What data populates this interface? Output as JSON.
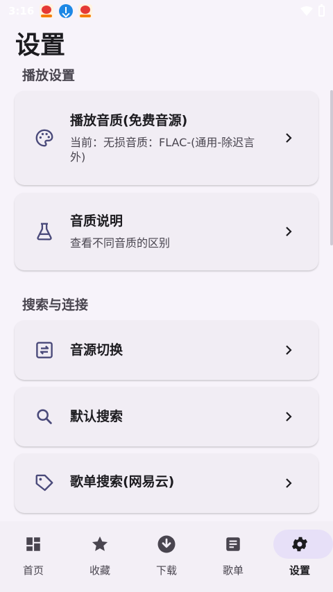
{
  "status_bar": {
    "time": "3:16",
    "notification_icons": [
      "app-notification-icon",
      "download-icon",
      "app-notification-icon"
    ],
    "right_icons": [
      "wifi-icon",
      "battery-icon"
    ]
  },
  "page": {
    "title": "设置"
  },
  "sections": [
    {
      "header": "播放设置",
      "items": [
        {
          "icon": "palette-icon",
          "title": "播放音质(免费音源)",
          "subtitle": "当前：无损音质：FLAC-(通用-除迟言外)"
        },
        {
          "icon": "flask-icon",
          "title": "音质说明",
          "subtitle": "查看不同音质的区别"
        }
      ]
    },
    {
      "header": "搜索与连接",
      "items": [
        {
          "icon": "swap-icon",
          "title": "音源切换"
        },
        {
          "icon": "search-icon",
          "title": "默认搜索"
        },
        {
          "icon": "tag-icon",
          "title": "歌单搜索(网易云)"
        }
      ]
    }
  ],
  "bottom_nav": {
    "active_index": 4,
    "active_color": "#e7e0f8",
    "items": [
      {
        "label": "首页",
        "icon": "dashboard-icon"
      },
      {
        "label": "收藏",
        "icon": "star-icon"
      },
      {
        "label": "下载",
        "icon": "download-circle-icon"
      },
      {
        "label": "歌单",
        "icon": "playlist-icon"
      },
      {
        "label": "设置",
        "icon": "gear-icon"
      }
    ]
  }
}
